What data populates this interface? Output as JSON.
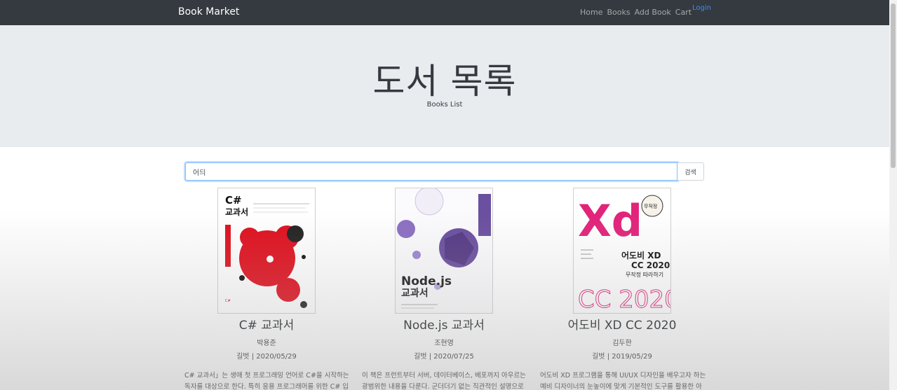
{
  "navbar": {
    "brand": "Book Market",
    "links": [
      "Home",
      "Books",
      "Add Book",
      "Cart"
    ],
    "login": "Login"
  },
  "jumbotron": {
    "title": "도서 목록",
    "subtitle": "Books List"
  },
  "search": {
    "value": "어듸",
    "button": "검색"
  },
  "books": [
    {
      "title": "C# 교과서",
      "author": "박용준",
      "publisher_date": "길벗 | 2020/05/29",
      "description": "C# 교과서」는 생애 첫 프로그래밍 언어로 C#을 시작하는 독자를 대상으로 한다. 특히 응용 프로그래머를 위한 C# 입문서로, C#을 사용하여 게임(유니",
      "cover_text": "C# 교과서"
    },
    {
      "title": "Node.js 교과서",
      "author": "조현영",
      "publisher_date": "길벗 | 2020/07/25",
      "description": "이 책은 프런트부터 서버, 데이터베이스, 배포까지 아우르는 광범위한 내용을 다룬다. 군더더기 없는 직관적인 설명으로 기본 개념을 확실히 이해하고,",
      "cover_text": "Node.js 교과서"
    },
    {
      "title": "어도비 XD CC 2020",
      "author": "김두한",
      "publisher_date": "길벗 | 2019/05/29",
      "description": "어도비 XD 프로그램을 통해 UI/UX 디자인을 배우고자 하는 예비 디자이너의 눈높이에 맞게 기본적인 도구를 활용한 아이콘 디자인과 웹&앱 페이지",
      "cover_text": "Xd 어도비 XD CC 2020 무작정 따라하기 CC 2020"
    }
  ],
  "colors": {
    "navbar": "#343a40",
    "jumbotron": "#e9ecef",
    "login_link": "#3b8cff",
    "csharp_red": "#e0101e",
    "node_purple": "#6b4fa0",
    "xd_pink": "#e2237a"
  }
}
